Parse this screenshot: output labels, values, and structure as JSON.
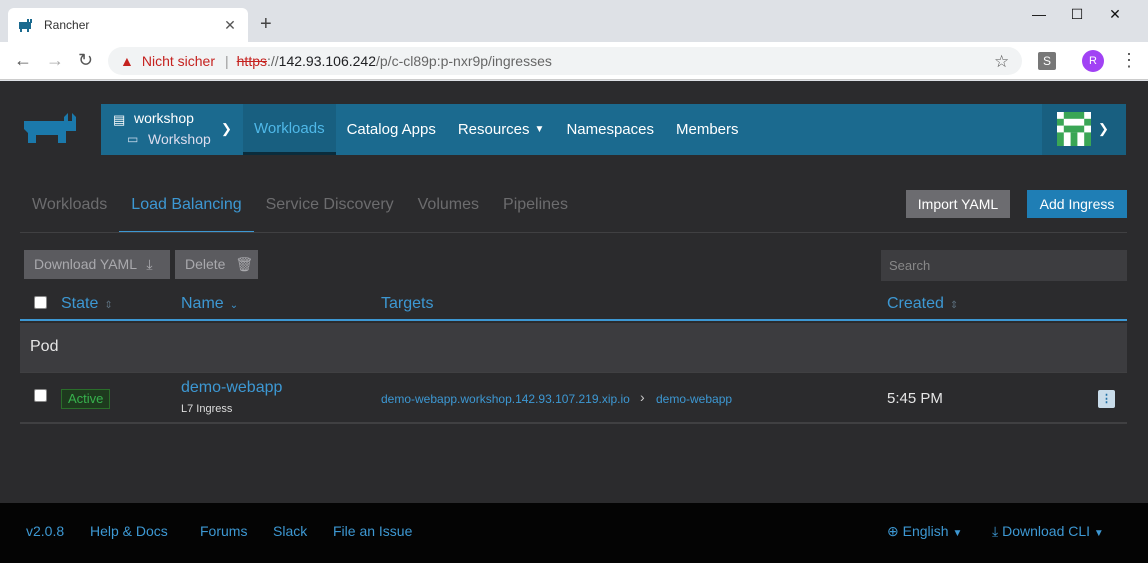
{
  "browser": {
    "tab_title": "Rancher",
    "tab_close": "✕",
    "new_tab": "+",
    "minimize": "—",
    "maximize": "☐",
    "close": "✕",
    "security_warning": "Nicht sicher",
    "url_scheme": "https",
    "url_sep": "://",
    "url_host": "142.93.106.242",
    "url_path": "/p/c-cl89p:p-nxr9p/ingresses",
    "profile_initial": "R",
    "extension_label": "S"
  },
  "header": {
    "project": {
      "cluster": "workshop",
      "name": "Workshop"
    },
    "nav": [
      "Workloads",
      "Catalog Apps",
      "Resources",
      "Namespaces",
      "Members"
    ]
  },
  "subtabs": [
    "Workloads",
    "Load Balancing",
    "Service Discovery",
    "Volumes",
    "Pipelines"
  ],
  "actions": {
    "import_yaml": "Import YAML",
    "add_ingress": "Add Ingress",
    "download_yaml": "Download YAML",
    "delete": "Delete",
    "search_placeholder": "Search"
  },
  "table": {
    "columns": {
      "state": "State",
      "name": "Name",
      "targets": "Targets",
      "created": "Created"
    },
    "group": "Pod",
    "rows": [
      {
        "state": "Active",
        "name": "demo-webapp",
        "subtitle": "L7 Ingress",
        "target_host": "demo-webapp.workshop.142.93.107.219.xip.io",
        "target_service": "demo-webapp",
        "created": "5:45 PM"
      }
    ]
  },
  "footer": {
    "version": "v2.0.8",
    "help": "Help & Docs",
    "forums": "Forums",
    "slack": "Slack",
    "issue": "File an Issue",
    "language": "English",
    "download_cli": "Download CLI"
  },
  "colors": {
    "accent": "#3d98d3",
    "nav_bg": "#1b6a8f",
    "app_bg": "#2b2b2d",
    "active_green": "#37b24d"
  }
}
